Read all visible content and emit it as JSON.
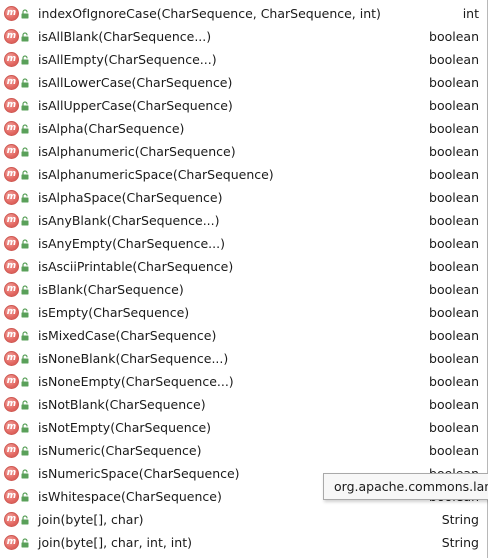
{
  "completion_list": {
    "items": [
      {
        "name": "indexOfIgnoreCase(CharSequence, CharSequence, int)",
        "type": "int"
      },
      {
        "name": "isAllBlank(CharSequence...)",
        "type": "boolean"
      },
      {
        "name": "isAllEmpty(CharSequence...)",
        "type": "boolean"
      },
      {
        "name": "isAllLowerCase(CharSequence)",
        "type": "boolean"
      },
      {
        "name": "isAllUpperCase(CharSequence)",
        "type": "boolean"
      },
      {
        "name": "isAlpha(CharSequence)",
        "type": "boolean"
      },
      {
        "name": "isAlphanumeric(CharSequence)",
        "type": "boolean"
      },
      {
        "name": "isAlphanumericSpace(CharSequence)",
        "type": "boolean"
      },
      {
        "name": "isAlphaSpace(CharSequence)",
        "type": "boolean"
      },
      {
        "name": "isAnyBlank(CharSequence...)",
        "type": "boolean"
      },
      {
        "name": "isAnyEmpty(CharSequence...)",
        "type": "boolean"
      },
      {
        "name": "isAsciiPrintable(CharSequence)",
        "type": "boolean"
      },
      {
        "name": "isBlank(CharSequence)",
        "type": "boolean"
      },
      {
        "name": "isEmpty(CharSequence)",
        "type": "boolean"
      },
      {
        "name": "isMixedCase(CharSequence)",
        "type": "boolean"
      },
      {
        "name": "isNoneBlank(CharSequence...)",
        "type": "boolean"
      },
      {
        "name": "isNoneEmpty(CharSequence...)",
        "type": "boolean"
      },
      {
        "name": "isNotBlank(CharSequence)",
        "type": "boolean"
      },
      {
        "name": "isNotEmpty(CharSequence)",
        "type": "boolean"
      },
      {
        "name": "isNumeric(CharSequence)",
        "type": "boolean"
      },
      {
        "name": "isNumericSpace(CharSequence)",
        "type": "boolean"
      },
      {
        "name": "isWhitespace(CharSequence)",
        "type": "boolean"
      },
      {
        "name": "join(byte[], char)",
        "type": "String"
      },
      {
        "name": "join(byte[], char, int, int)",
        "type": "String"
      }
    ],
    "item_icon": "method-icon",
    "item_access_icon": "public-lock-icon",
    "colors": {
      "method_icon": "#e46b65",
      "lock_icon": "#5aa05a",
      "text": "#1a1a1a",
      "tooltip_bg": "#f7f7f7",
      "tooltip_border": "#a9a9a9"
    }
  },
  "tooltip": {
    "text": "org.apache.commons.lang"
  }
}
